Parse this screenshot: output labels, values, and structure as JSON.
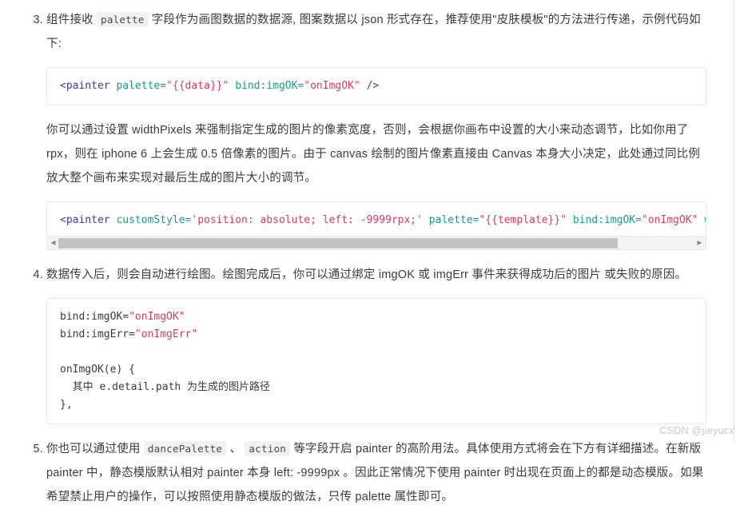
{
  "page": {
    "watermark": "CSDN @jieyucx"
  },
  "items": [
    {
      "marker": "3.",
      "text_1": "组件接收 ",
      "code_1": "palette",
      "text_2": " 字段作为画图数据的数据源, 图案数据以 json 形式存在，推荐使用\"皮肤模板\"的方法进行传递，示例代码如下:"
    },
    {
      "marker": "4.",
      "text_1": "数据传入后，则会自动进行绘图。绘图完成后，你可以通过绑定 imgOK 或 imgErr 事件来获得成功后的图片 或失败的原因。"
    },
    {
      "marker": "5.",
      "text_1": "你也可以通过使用 ",
      "code_1": "dancePalette",
      "text_2": " 、 ",
      "code_2": "action",
      "text_3": " 等字段开启 painter 的高阶用法。具体使用方式将会在下方有详细描述。在新版 painter 中，静态模版默认相对 painter 本身 left: -9999px 。因此正常情况下使用 painter 时出现在页面上的都是动态模版。如果希望禁止用户的操作，可以按照使用静态模版的做法，只传 palette 属性即可。"
    }
  ],
  "paragraph": {
    "text": "你可以通过设置 widthPixels 来强制指定生成的图片的像素宽度，否则，会根据你画布中设置的大小来动态调节，比如你用了 rpx，则在 iphone 6 上会生成 0.5 倍像素的图片。由于 canvas 绘制的图片像素直接由 Canvas 本身大小决定，此处通过同比例放大整个画布来实现对最后生成的图片大小的调节。"
  },
  "code_blocks": [
    {
      "id": "code-block-1",
      "scrollable": false,
      "tokens": [
        {
          "t": "tag",
          "v": "<painter"
        },
        {
          "t": "plain",
          "v": " "
        },
        {
          "t": "attr",
          "v": "palette="
        },
        {
          "t": "str",
          "v": "\"{{data}}\""
        },
        {
          "t": "plain",
          "v": " "
        },
        {
          "t": "attr",
          "v": "bind:imgOK="
        },
        {
          "t": "str",
          "v": "\"onImgOK\""
        },
        {
          "t": "plain",
          "v": " "
        },
        {
          "t": "tag",
          "v": "/>"
        }
      ]
    },
    {
      "id": "code-block-2",
      "scrollable": true,
      "scrollbar": {
        "thumb_percent": 88,
        "left_arrow": "◀",
        "right_arrow": "▶"
      },
      "tokens": [
        {
          "t": "tag",
          "v": "<painter"
        },
        {
          "t": "plain",
          "v": " "
        },
        {
          "t": "attr",
          "v": "customStyle="
        },
        {
          "t": "str",
          "v": "'position: absolute; left: -9999rpx;'"
        },
        {
          "t": "plain",
          "v": " "
        },
        {
          "t": "attr",
          "v": "palette="
        },
        {
          "t": "str",
          "v": "\"{{template}}\""
        },
        {
          "t": "plain",
          "v": " "
        },
        {
          "t": "attr",
          "v": "bind:imgOK="
        },
        {
          "t": "str",
          "v": "\"onImgOK\""
        },
        {
          "t": "plain",
          "v": " "
        },
        {
          "t": "attr",
          "v": "widthPixe"
        }
      ]
    },
    {
      "id": "code-block-3",
      "scrollable": false,
      "lines": [
        [
          {
            "t": "plain",
            "v": "bind:imgOK="
          },
          {
            "t": "str",
            "v": "\"onImgOK\""
          }
        ],
        [
          {
            "t": "plain",
            "v": "bind:imgErr="
          },
          {
            "t": "str",
            "v": "\"onImgErr\""
          }
        ],
        [],
        [
          {
            "t": "plain",
            "v": "onImgOK(e) {"
          }
        ],
        [
          {
            "t": "plain",
            "v": "  其中 e.detail.path 为生成的图片路径"
          }
        ],
        [
          {
            "t": "plain",
            "v": "},"
          }
        ]
      ]
    }
  ]
}
